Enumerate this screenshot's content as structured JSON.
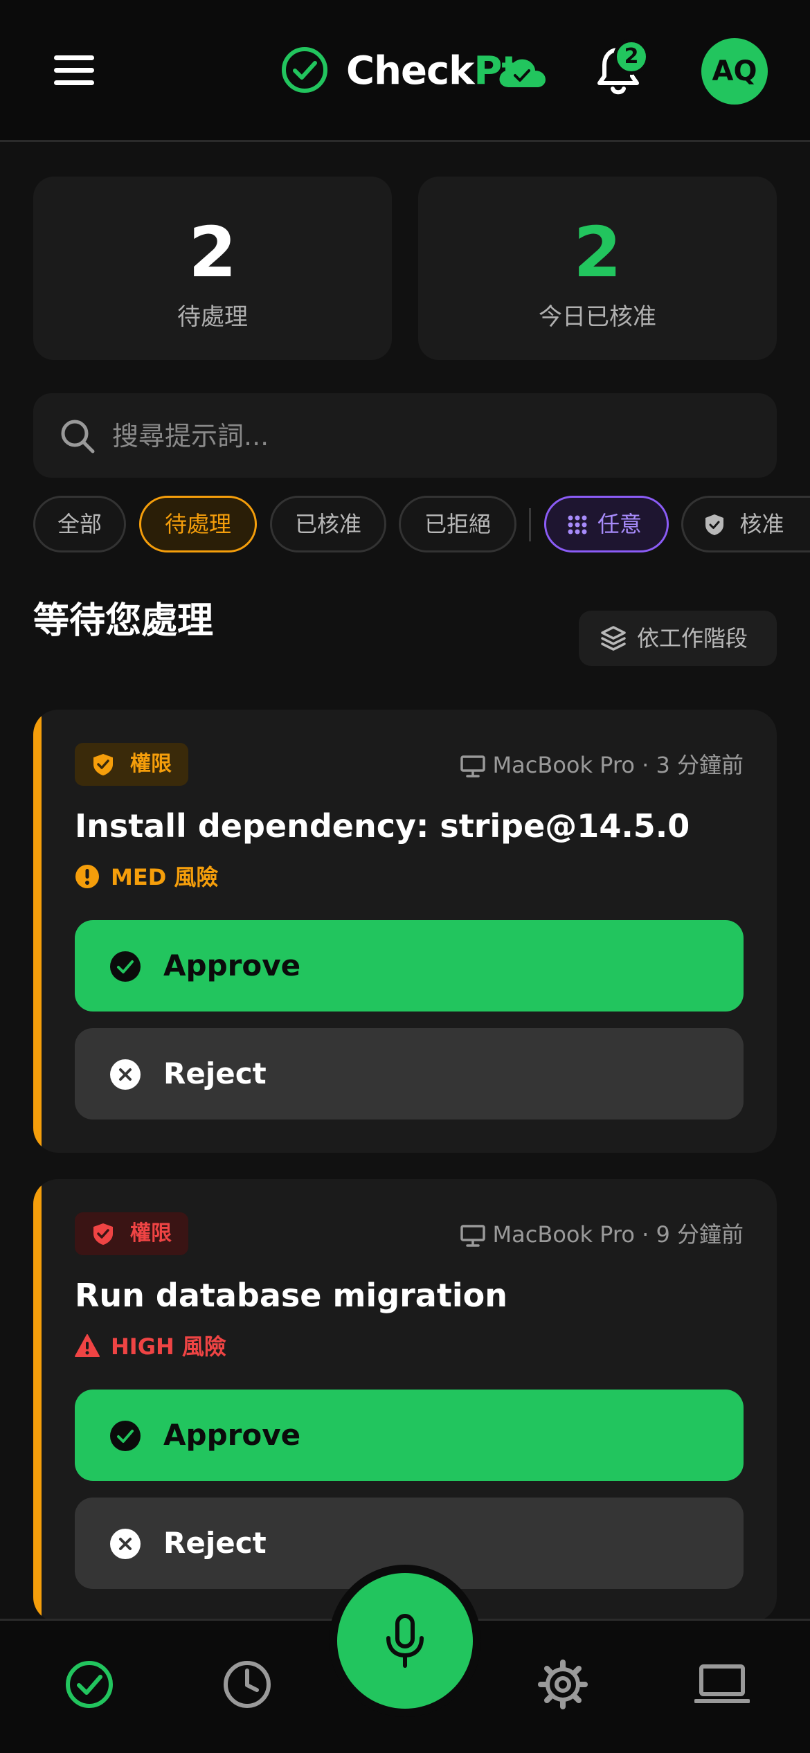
{
  "header": {
    "brand_check": "Check",
    "brand_pt": "Pt",
    "notification_count": "2",
    "avatar_initials": "AQ"
  },
  "stats": {
    "pending_count": "2",
    "pending_label": "待處理",
    "approved_today_count": "2",
    "approved_today_label": "今日已核准"
  },
  "search": {
    "placeholder": "搜尋提示詞..."
  },
  "filters": {
    "chips": [
      "全部",
      "待處理",
      "已核准",
      "已拒絕"
    ],
    "active_index": 1,
    "mode_any": "任意",
    "mode_approve": "核准"
  },
  "section": {
    "title": "等待您處理",
    "group_button": "依工作階段"
  },
  "requests": [
    {
      "tag": "權限",
      "device": "MacBook Pro",
      "time_ago": "3 分鐘前",
      "title": "Install dependency: stripe@14.5.0",
      "risk": "MED 風險",
      "approve_label": "Approve",
      "reject_label": "Reject"
    },
    {
      "tag": "權限",
      "device": "MacBook Pro",
      "time_ago": "9 分鐘前",
      "title": "Run database migration",
      "risk": "HIGH 風險",
      "approve_label": "Approve",
      "reject_label": "Reject"
    }
  ],
  "nav": {
    "items": [
      "checkpoint-icon",
      "history-icon",
      "microphone-icon",
      "gear-icon",
      "laptop-icon"
    ]
  },
  "colors": {
    "accent": "#22c55e",
    "warning": "#f59e0b",
    "danger": "#ef4444",
    "purple": "#8b5cf6",
    "background": "#111111",
    "card": "#1b1b1b"
  }
}
